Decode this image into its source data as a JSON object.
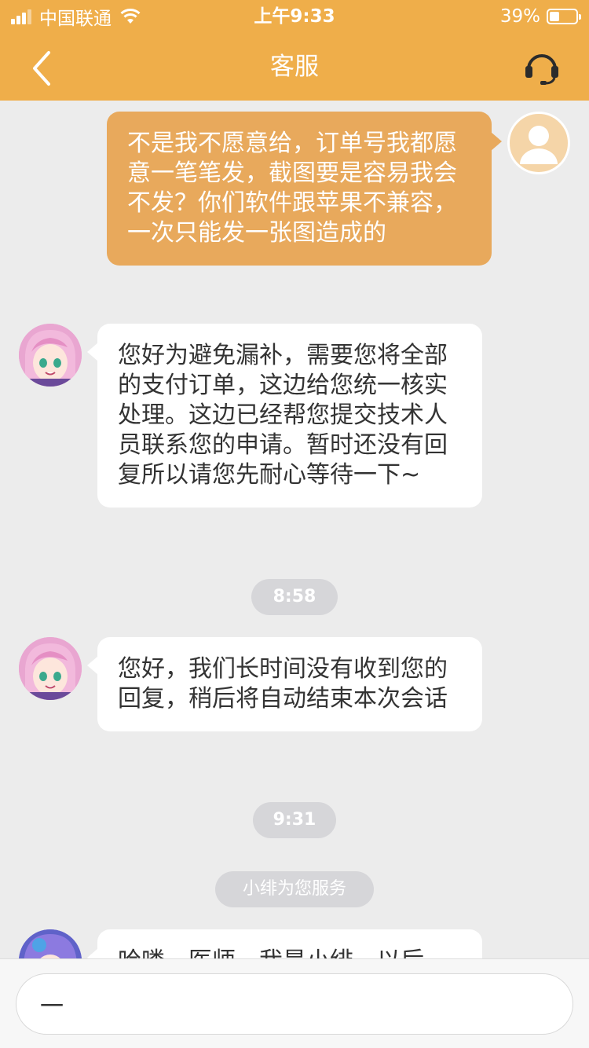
{
  "status_bar": {
    "carrier": "中国联通",
    "time": "上午9:33",
    "battery": "39%",
    "battery_level": 0.39
  },
  "header": {
    "title": "客服",
    "accent_color": "#efae4a"
  },
  "messages": [
    {
      "from": "user",
      "text": "不是我不愿意给，订单号我都愿意一笔笔发，截图要是容易我会不发？你们软件跟苹果不兼容，一次只能发一张图造成的"
    },
    {
      "from": "agent",
      "text": "您好为避免漏补，需要您将全部的支付订单，这边给您统一核实处理。这边已经帮您提交技术人员联系您的申请。暂时还没有回复所以请您先耐心等待一下~"
    },
    {
      "type": "time",
      "text": "8:58"
    },
    {
      "from": "agent",
      "text": "您好，我们长时间没有收到您的回复，稍后将自动结束本次会话"
    },
    {
      "type": "time",
      "text": "9:31"
    },
    {
      "type": "system",
      "text": "小绯为您服务"
    },
    {
      "from": "agent",
      "text": "哈喽，医师，我是小绯，以后"
    }
  ],
  "input": {
    "value": "一"
  }
}
